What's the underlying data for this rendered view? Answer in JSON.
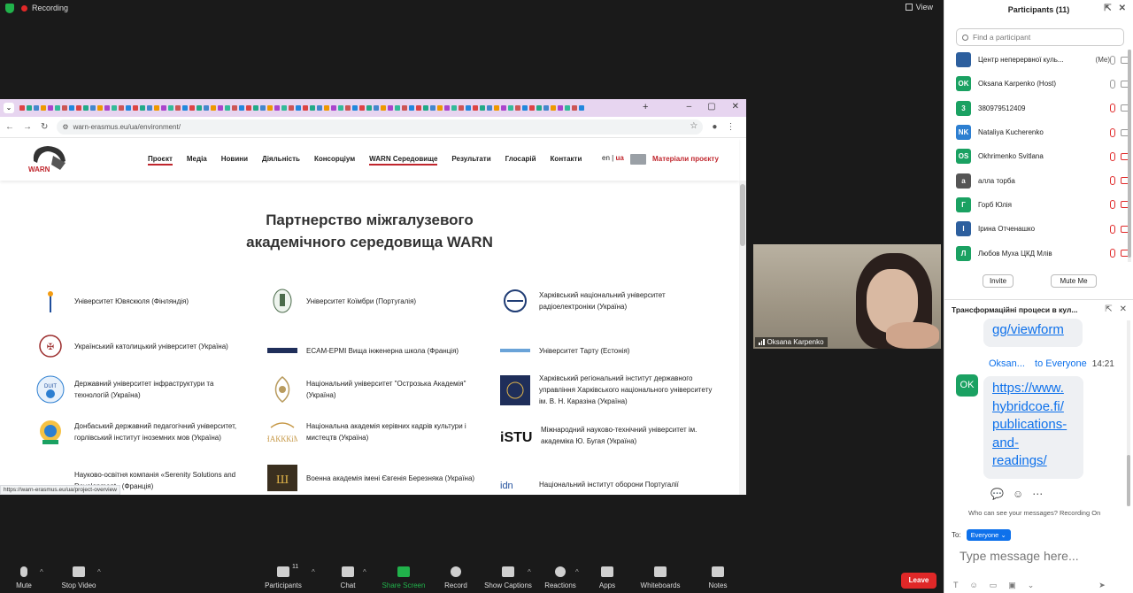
{
  "topbar": {
    "recording_label": "Recording",
    "view_label": "View"
  },
  "browser": {
    "url": "warn-erasmus.eu/ua/environment/",
    "status_url": "https://warn-erasmus.eu/ua/project-overview",
    "window_controls": [
      "–",
      "▢",
      "✕"
    ]
  },
  "site": {
    "logo_text": "WARN",
    "menu": [
      "Проєкт",
      "Медіа",
      "Новини",
      "Діяльність",
      "Консорціум",
      "WARN Середовище",
      "Результати",
      "Глосарій",
      "Контакти"
    ],
    "lang_en": "en",
    "lang_ua": "ua",
    "materials": "Матеріали проєкту",
    "title_line1": "Партнерство міжгалузевого",
    "title_line2": "академічного середовища WARN",
    "universities": [
      "Університет Ювяскюля (Фінляндія)",
      "Університет Коїмбри (Португалія)",
      "Харківський національний університет радіоелектроніки (Україна)",
      "Український католицький університет (Україна)",
      "ECAM-EPMI Вища інженерна школа (Франція)",
      "Університет Тарту (Естонія)",
      "Державний університет інфраструктури та технологій (Україна)",
      "Національний університет \"Острозька Академія\" (Україна)",
      "Харківський регіональний інститут державного управління Харківського національного університету ім. В. Н. Каразіна (Україна)",
      "Донбаський державний педагогічний університет, горлівський інститут іноземних мов (Україна)",
      "Національна академія керівних кадрів культури і мистецтв (Україна)",
      "Міжнародний науково-технічний університет ім. академіка Ю. Бугая (Україна)",
      "Науково-освітня компанія «Serenity Solutions and Development» (Франція)",
      "Военна академія імені Євгенія Березняка (Україна)",
      "Національний інститут оборони Португалії"
    ]
  },
  "video": {
    "name": "Oksana Karpenko"
  },
  "toolbar": {
    "mute": "Mute",
    "stop_video": "Stop Video",
    "participants": "Participants",
    "participants_count": "11",
    "chat": "Chat",
    "share_screen": "Share Screen",
    "record": "Record",
    "show_captions": "Show Captions",
    "reactions": "Reactions",
    "apps": "Apps",
    "whiteboards": "Whiteboards",
    "notes": "Notes",
    "leave": "Leave"
  },
  "participants_panel": {
    "title": "Participants (11)",
    "search_placeholder": "Find a participant",
    "invite": "Invite",
    "mute_me": "Mute Me",
    "list": [
      {
        "initials": "",
        "name": "Центр неперервної куль...",
        "tag": "(Me)",
        "color": "#2d5f9e"
      },
      {
        "initials": "OK",
        "name": "Oksana Karpenko (Host)",
        "tag": "",
        "color": "#1aa162"
      },
      {
        "initials": "3",
        "name": "380979512409",
        "tag": "",
        "color": "#1aa162"
      },
      {
        "initials": "NK",
        "name": "Nataliya Kucherenko",
        "tag": "",
        "color": "#2d7fd1"
      },
      {
        "initials": "OS",
        "name": "Okhrimenko Svitlana",
        "tag": "",
        "color": "#1aa162"
      },
      {
        "initials": "а",
        "name": "алла торба",
        "tag": "",
        "color": "#555555"
      },
      {
        "initials": "Г",
        "name": "Горб Юлія",
        "tag": "",
        "color": "#1aa162"
      },
      {
        "initials": "І",
        "name": "Ірина Отченашко",
        "tag": "",
        "color": "#2d5f9e"
      },
      {
        "initials": "Л",
        "name": "Любов Муха ЦКД Млів",
        "tag": "",
        "color": "#1aa162"
      }
    ]
  },
  "chat_panel": {
    "title": "Трансформаційні процеси в кул...",
    "prev_link_tail": "gg/viewform",
    "sender": "Oksan...",
    "to": "to Everyone",
    "time": "14:21",
    "avatar": "OK",
    "link_lines": [
      "https://www.",
      "hybridcoe.fi/",
      "publications-",
      "and-",
      "readings/"
    ],
    "notice": "Who can see your messages? Recording On",
    "to_label": "To:",
    "to_value": "Everyone",
    "input_placeholder": "Type message here..."
  }
}
